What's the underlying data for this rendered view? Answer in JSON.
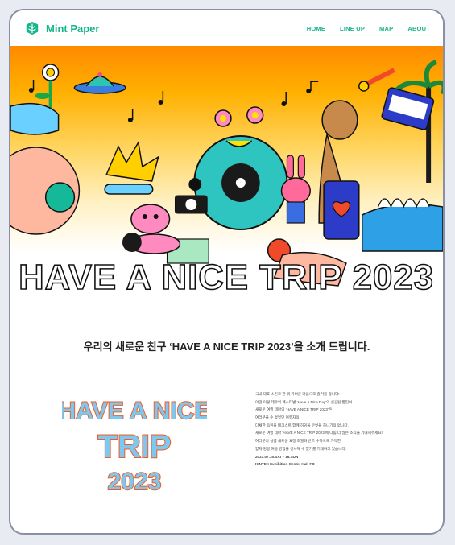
{
  "brand": {
    "name": "Mint Paper",
    "color": "#16b58a"
  },
  "nav": [
    {
      "label": "HOME"
    },
    {
      "label": "LINE UP"
    },
    {
      "label": "MAP"
    },
    {
      "label": "ABOUT"
    }
  ],
  "hero": {
    "title": "HAVE A NICE TRIP 2023"
  },
  "intro": {
    "headline": "우리의 새로운 친구 ‘HAVE A NICE TRIP 2023’을 소개 드립니다."
  },
  "logo_art": {
    "line1": "HAVE A NICE",
    "line2": "TRIP",
    "line3": "2023"
  },
  "description": [
    "국내 대표 스킨로 한 뭐 가벼운 마음으로 즐겨볼 겁니다!",
    "어떤 이렇 테마의 페스티벌 ‘Have A Nice Day’의 설공된 짧입이.",
    "새로운 여행 테마의 ‘HAVE A NICE TRIP 2023’은",
    "여러분을 수 없었던 여행자의",
    "다채한 음원을 테크스트 함께 허밍을 무엇을 하나기의 없니다.",
    "새로운 여행 테마 ‘HAVE A NICE TRIP 2023’에 다림 더 많은 소식을 기대해주세요!",
    "여러분의 설렘 새로운 요정 초월과 반드 수하으로 가득한",
    "양자 명랑 여름 경험을 선사해 수 있기를 기대하고 있습니다."
  ],
  "event": {
    "date": "2023.07.15.SAT - 16.SUN",
    "venue": "KINTEX Exhibition Center Hall 7,8"
  },
  "colors": {
    "accent": "#16b58a",
    "event": "#f05a24"
  }
}
